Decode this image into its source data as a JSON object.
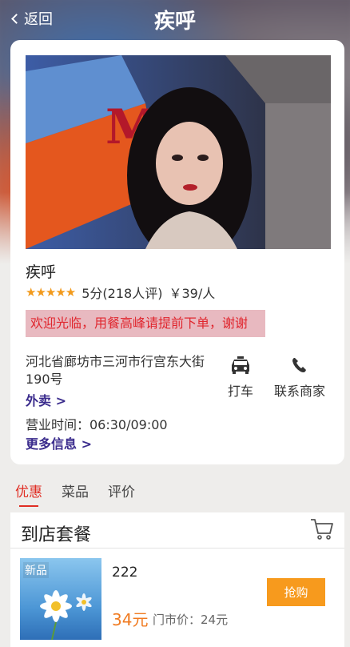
{
  "header": {
    "back_label": "返回",
    "title": "疾呼"
  },
  "store": {
    "name": "疾呼",
    "stars": "★★★★★",
    "rating_text": "5分(218人评)",
    "price_per_person": "￥39/人",
    "notice": "欢迎光临，用餐高峰请提前下单，谢谢",
    "address": "河北省廊坊市三河市行宫东大街190号",
    "takeout_link": "外卖 >",
    "hours": "营业时间：06:30/09:00",
    "more_info_link": "更多信息 >",
    "actions": {
      "taxi_label": "打车",
      "contact_label": "联系商家"
    }
  },
  "tabs": [
    {
      "label": "优惠"
    },
    {
      "label": "菜品"
    },
    {
      "label": "评价"
    }
  ],
  "section": {
    "title": "到店套餐"
  },
  "deal": {
    "badge": "新品",
    "name": "222",
    "price": "34元",
    "original_price": "门市价：24元",
    "buy_label": "抢购"
  },
  "colors": {
    "accent_red": "#e02e24",
    "star_orange": "#f29a1c",
    "buy_button": "#f79a1d",
    "link_purple": "#3a2b8c"
  }
}
